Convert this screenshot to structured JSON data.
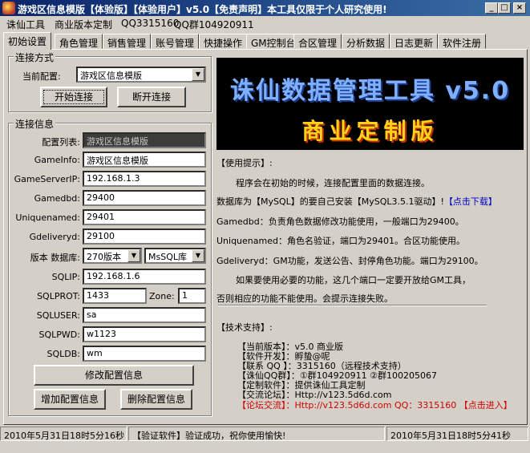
{
  "window": {
    "title": "游戏区信息模版【体验版】【体验用户】v5.0【免责声明】本工具仅限于个人研究使用!",
    "min": "_",
    "max": "□",
    "close": "×"
  },
  "menu": [
    "诛仙工具",
    "商业版本定制",
    "QQ3315160",
    "QQ群104920911"
  ],
  "tabs": [
    "初始设置",
    "角色管理",
    "销售管理",
    "账号管理",
    "快捷操作",
    "GM控制台",
    "合区管理",
    "分析数据",
    "日志更新",
    "软件注册"
  ],
  "connection": {
    "legend": "连接方式",
    "config_label": "当前配置:",
    "config_value": "游戏区信息模版",
    "start_button": "开始连接",
    "disconnect_button": "断开连接"
  },
  "conn_info": {
    "legend": "连接信息",
    "list_label": "配置列表:",
    "list_value": "游戏区信息模版",
    "gameinfo_label": "GameInfo:",
    "gameinfo_value": "游戏区信息模版",
    "gameserverip_label": "GameServerIP:",
    "gameserverip_value": "192.168.1.3",
    "gamedbd_label": "Gamedbd:",
    "gamedbd_value": "29400",
    "uniquenamed_label": "Uniquenamed:",
    "uniquenamed_value": "29401",
    "gdeliveryd_label": "Gdeliveryd:",
    "gdeliveryd_value": "29100",
    "version_label": "版本 数据库:",
    "version_value": "270版本",
    "db_value": "MsSQL库",
    "sqlip_label": "SQLIP:",
    "sqlip_value": "192.168.1.6",
    "sqlport_label": "SQLPROT:",
    "sqlport_value": "1433",
    "zone_label": "Zone:",
    "zone_value": "1",
    "sqluser_label": "SQLUSER:",
    "sqluser_value": "sa",
    "sqlpwd_label": "SQLPWD:",
    "sqlpwd_value": "w1123",
    "sqldb_label": "SQLDB:",
    "sqldb_value": "wm",
    "modify_button": "修改配置信息",
    "add_button": "增加配置信息",
    "delete_button": "删除配置信息"
  },
  "banner": {
    "line1": "诛仙数据管理工具 v5.0",
    "line2": "商业定制版"
  },
  "tips": {
    "heading": "【使用提示】:",
    "p1": "程序会在初始的时候，连接配置里面的数据连接。",
    "p2a": "数据库为【MySQL】的要自己安装【MySQL3.5.1驱动】!",
    "p2b": "【点击下载】",
    "p3": "Gamedbd：负责角色数据修改功能使用，一般端口为29400。",
    "p4": "Uniquenamed：角色名验证，端口为29401。合区功能使用。",
    "p5": "Gdeliveryd：GM功能，发送公告、封停角色功能。端口为29100。",
    "p6": "如果要使用必要的功能，这几个端口一定要开放给GM工具，",
    "p7": "否则相应的功能不能使用。会提示连接失败。"
  },
  "support": {
    "heading": "【技术支持】:",
    "r1": "【当前版本】：v5.0 商业版",
    "r2": "【软件开发】：孵蛰@呢",
    "r3": "【联系 QQ 】：3315160（远程技术支持）",
    "r4": "【诛仙QQ群】：①群104920911 ②群100205067",
    "r5": "【定制软件】：提供诛仙工具定制",
    "r6": "【交流论坛】：Http://v123.5d6d.com",
    "r7a": "【论坛交流】：Http://v123.5d6d.com QQ：3315160",
    "r7b": "【点击进入】"
  },
  "status": {
    "left": "2010年5月31日18时5分16秒",
    "middle": "【验证软件】验证成功，祝你使用愉快!",
    "right": "2010年5月31日18时5分41秒"
  }
}
